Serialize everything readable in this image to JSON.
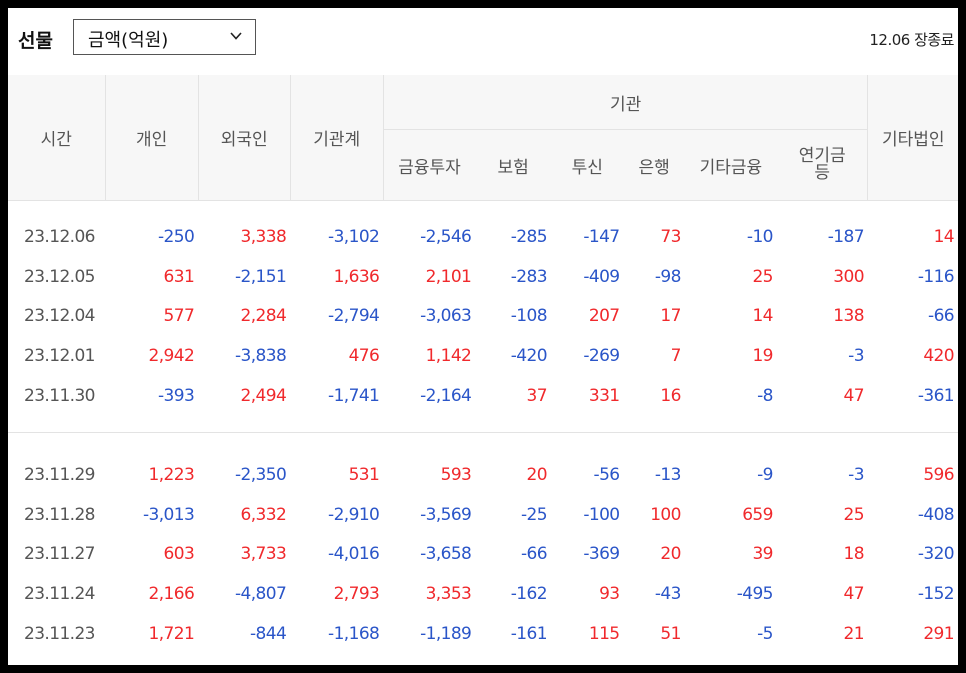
{
  "header": {
    "title": "선물",
    "select_value": "금액(억원)",
    "status": "12.06 장종료"
  },
  "columns": {
    "time": "시간",
    "individual": "개인",
    "foreign": "외국인",
    "institution_total": "기관계",
    "institution_group": "기관",
    "sub": [
      "금융투자",
      "보험",
      "투신",
      "은행",
      "기타금융",
      "연기금\n등"
    ],
    "other_corp": "기타법인"
  },
  "rows_group1": [
    [
      "23.12.06",
      "-250",
      "3,338",
      "-3,102",
      "-2,546",
      "-285",
      "-147",
      "73",
      "-10",
      "-187",
      "14"
    ],
    [
      "23.12.05",
      "631",
      "-2,151",
      "1,636",
      "2,101",
      "-283",
      "-409",
      "-98",
      "25",
      "300",
      "-116"
    ],
    [
      "23.12.04",
      "577",
      "2,284",
      "-2,794",
      "-3,063",
      "-108",
      "207",
      "17",
      "14",
      "138",
      "-66"
    ],
    [
      "23.12.01",
      "2,942",
      "-3,838",
      "476",
      "1,142",
      "-420",
      "-269",
      "7",
      "19",
      "-3",
      "420"
    ],
    [
      "23.11.30",
      "-393",
      "2,494",
      "-1,741",
      "-2,164",
      "37",
      "331",
      "16",
      "-8",
      "47",
      "-361"
    ]
  ],
  "rows_group2": [
    [
      "23.11.29",
      "1,223",
      "-2,350",
      "531",
      "593",
      "20",
      "-56",
      "-13",
      "-9",
      "-3",
      "596"
    ],
    [
      "23.11.28",
      "-3,013",
      "6,332",
      "-2,910",
      "-3,569",
      "-25",
      "-100",
      "100",
      "659",
      "25",
      "-408"
    ],
    [
      "23.11.27",
      "603",
      "3,733",
      "-4,016",
      "-3,658",
      "-66",
      "-369",
      "20",
      "39",
      "18",
      "-320"
    ],
    [
      "23.11.24",
      "2,166",
      "-4,807",
      "2,793",
      "3,353",
      "-162",
      "93",
      "-43",
      "-495",
      "47",
      "-152"
    ],
    [
      "23.11.23",
      "1,721",
      "-844",
      "-1,168",
      "-1,189",
      "-161",
      "115",
      "51",
      "-5",
      "21",
      "291"
    ]
  ],
  "colors": {
    "positive": "#f0292c",
    "negative": "#2a55c8"
  },
  "icons": {
    "dropdown": "chevron-down-icon"
  }
}
